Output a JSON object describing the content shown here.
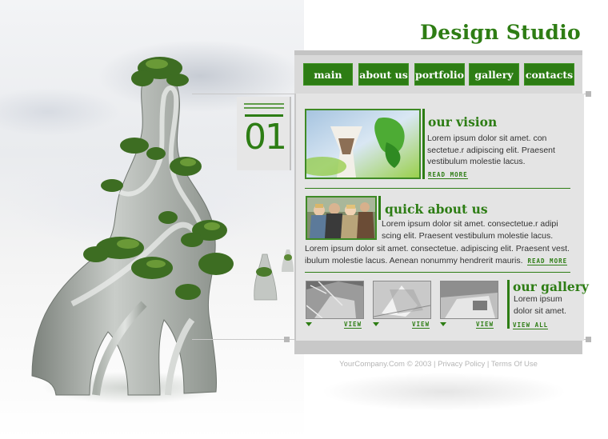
{
  "brand": {
    "title": "Design Studio"
  },
  "nav": {
    "items": [
      {
        "label": "main"
      },
      {
        "label": "about us"
      },
      {
        "label": "portfolio"
      },
      {
        "label": "gallery"
      },
      {
        "label": "contacts"
      }
    ]
  },
  "badge": {
    "number": "01"
  },
  "vision": {
    "heading": "our vision",
    "text": "Lorem ipsum dolor sit amet.  con sectetue.r adipiscing elit. Praesent vestibulum molestie lacus.",
    "link": "READ MORE"
  },
  "about": {
    "heading": "quick about us",
    "text_right": "Lorem ipsum dolor sit amet.  consectetue.r adipi scing elit. Praesent vestibulum molestie lacus.",
    "text_full": "Lorem ipsum dolor sit amet.  consectetue. adipiscing elit. Praesent vest. ibulum molestie lacus. Aenean nonummy hendrerit mauris.",
    "link": "READ MORE"
  },
  "gallery": {
    "heading": "our gallery",
    "text": "Lorem ipsum dolor sit amet.",
    "thumbs": [
      {
        "link": "VIEW"
      },
      {
        "link": "VIEW"
      },
      {
        "link": "VIEW"
      }
    ],
    "view_all": "VIEW ALL"
  },
  "footer": {
    "copyright": "YourCompany.Com © 2003",
    "sep1": "|",
    "privacy": "Privacy Policy",
    "sep2": "|",
    "terms": "Terms Of Use"
  },
  "colors": {
    "accent": "#2d7d14",
    "panel": "#e4e4e4",
    "nav_bg": "#d9d9d9"
  }
}
